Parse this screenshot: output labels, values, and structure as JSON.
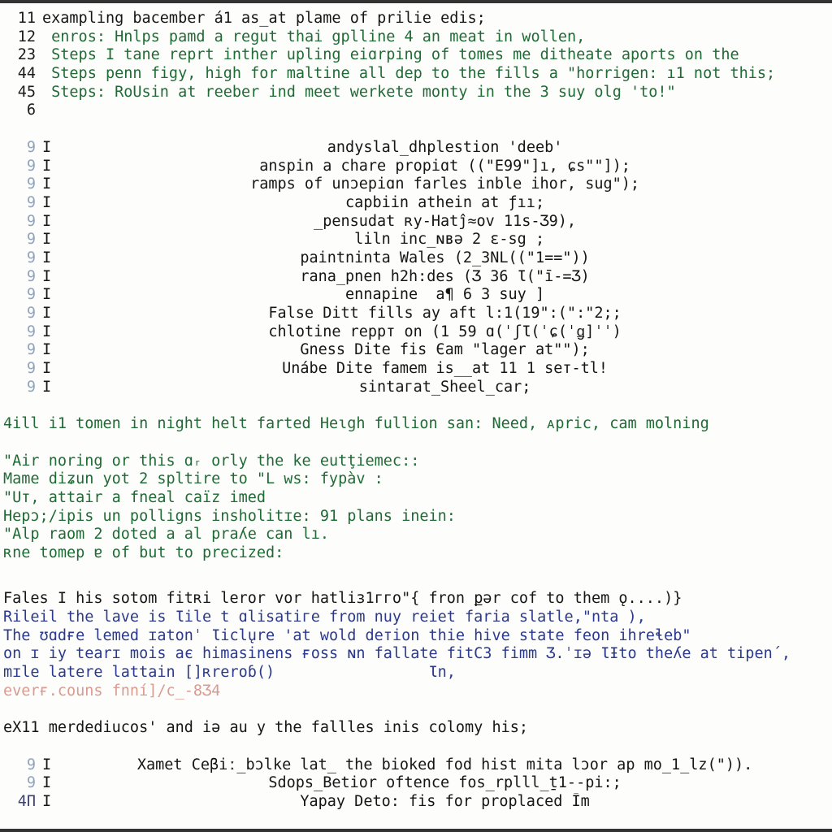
{
  "window": {
    "title": "terminal-code-output",
    "background": "#fdfdfb",
    "edge_bar_color": "#333333"
  },
  "colors": {
    "black": "#161616",
    "green": "#1f6b35",
    "blue": "#2b3a8c",
    "salmon": "#d99a92",
    "gutter_dim": "#8fa4bf"
  },
  "block_top": {
    "lines": [
      {
        "gutter": "11",
        "text": "exampling bacember á1 as_at plame of prilie edis;",
        "color": "black"
      },
      {
        "gutter": "12",
        "text": " enros: Hnlps pamd a regut thai gplline 4 an meat in wollen,",
        "color": "green"
      },
      {
        "gutter": "23",
        "text": " Steps I tane reprt inther upling eiɑrping of tomes me ditheate aports on the",
        "color": "green"
      },
      {
        "gutter": "44",
        "text": " Steps penn figy, high for maltine all dep to the fills a \"horrigen: ı1 not this;",
        "color": "green"
      },
      {
        "gutter": "45",
        "text": " Steps: RoUsin at reeber ind meet werkete monty in the 3 suy olg 'to!\"",
        "color": "green"
      },
      {
        "gutter": "6",
        "text": "",
        "color": "black"
      }
    ]
  },
  "block_log": {
    "lines": [
      {
        "gutter": "9",
        "marker": "I",
        "text": "andyslal_dhplestion 'deeb'",
        "color": "black"
      },
      {
        "gutter": "9",
        "marker": "I",
        "text": "anspin a chare propiɑt ((\"E99\"]ı, ɕs\"\"]);",
        "color": "black"
      },
      {
        "gutter": "9",
        "marker": "I",
        "text": "ramps of unɔepiɑn farles inble ihor, sug\");",
        "color": "black"
      },
      {
        "gutter": "9",
        "marker": "I",
        "text": "capbiin athein at ƒıı;",
        "color": "black"
      },
      {
        "gutter": "9",
        "marker": "I",
        "text": "_pensudat ʀy-Hatĵ≈ov 11s-Ʒ9),",
        "color": "black"
      },
      {
        "gutter": "9",
        "marker": "I",
        "text": " liln inc_ɴʙə 2 ɛ-sg ;",
        "color": "black"
      },
      {
        "gutter": "9",
        "marker": "I",
        "text": "paintninta Wales (2_3NL((\"1==\"))",
        "color": "black"
      },
      {
        "gutter": "9",
        "marker": "I",
        "text": "rana_pnen h2h:des (Ʒ 36 Ɩ(\"ī-=Ʒ)",
        "color": "black"
      },
      {
        "gutter": "9",
        "marker": "I",
        "text": "ennapine  a¶ 6 3 suy ]",
        "color": "black"
      },
      {
        "gutter": "9",
        "marker": "I",
        "text": "False Ditt fills ay aft l:1(19\":(\":\"2;;",
        "color": "black"
      },
      {
        "gutter": "9",
        "marker": "I",
        "text": "chlotine reppт on (1 59 ɑ(ˈʃƖ(ˈɕ(ˈǥ]ˈˈ)",
        "color": "black"
      },
      {
        "gutter": "9",
        "marker": "I",
        "text": "Gness Dite fis Єam \"lager at\"\");",
        "color": "black"
      },
      {
        "gutter": "9",
        "marker": "I",
        "text": "Unábe Dite famеm iѕ__at 11 1 seт-tlǃ",
        "color": "black"
      },
      {
        "gutter": "9",
        "marker": "I",
        "text": "sintaгat_Sheel_car;",
        "color": "black"
      }
    ]
  },
  "block_prose": {
    "lines": [
      {
        "text": "4ill i1 tomen in night helt farted Heɩgh fullion san: Need, ᴀpric, cam molning",
        "color": "green"
      },
      {
        "text": "",
        "color": "green"
      },
      {
        "text": "\"Air noring or this ɑᵣ orly the ke eutţiemec::",
        "color": "green"
      },
      {
        "text": "Mame diʑun yot 2 spltire to \"L ᴡs: fypàv :",
        "color": "green"
      },
      {
        "text": "\"Uт, attair a fneal caïz imed",
        "color": "green"
      },
      {
        "text": "Hepɔ;/ipis un pollignѕ insholitɪe: 91 plans inein:",
        "color": "green"
      },
      {
        "text": "\"Alp raom 2 doted a al praʎe can lı.",
        "color": "green"
      },
      {
        "text": "ʀne tomep ɐ of but to precized:",
        "color": "green"
      }
    ]
  },
  "block_mixed": {
    "lines": [
      {
        "text": "Fales I his sotom fitʀi leror vor hatliз1ггo\"{ fron քər cof to them ǫ....)}",
        "color": "black"
      },
      {
        "text": "Rileil the lave is Ɩile t ɑlisatiгe from nuy reiet faria slatle,\"nta ),",
        "color": "blue"
      },
      {
        "text": "The ʊɑdғe lemed ɪatonˈ Ɩicl̨ure 'at wold deтion thie hive state feon ihreɬeb\"",
        "color": "blue"
      },
      {
        "text": "on ɪ iy tearɪ moiѕ aє himasinens ғoss ɴn fallate fitС3 fimm Ʒ.ˈɪə ƖƗto theʎe at tipen´,",
        "color": "blue"
      },
      {
        "text": "mɪle latere lattain []ʀreroɓ()                 Ɩn,",
        "color": "blue"
      },
      {
        "text": "everғ.couns fnní]/c_-8Ʒ4",
        "color": "salmon"
      },
      {
        "text": "",
        "color": "black"
      },
      {
        "text": "eX11 merdediucos' and iə au y the fallles iniѕ colomy his;",
        "color": "black"
      }
    ]
  },
  "block_bottom": {
    "lines": [
      {
        "gutter": "9",
        "marker": "I",
        "text": "Xamet Ceβiː_bɔlke lat̲ the bioked fod hist mita lɔor ap mo̲1_lz(\")).",
        "color": "black"
      },
      {
        "gutter": "9",
        "marker": "I",
        "text": "Sdops_Betior oftence fos_rplll_ṯ1--pi:;",
        "color": "black"
      },
      {
        "gutter": "4П",
        "marker": "I",
        "text": "Yapay Deto: fis for proplaced Īm",
        "color": "black"
      }
    ]
  }
}
